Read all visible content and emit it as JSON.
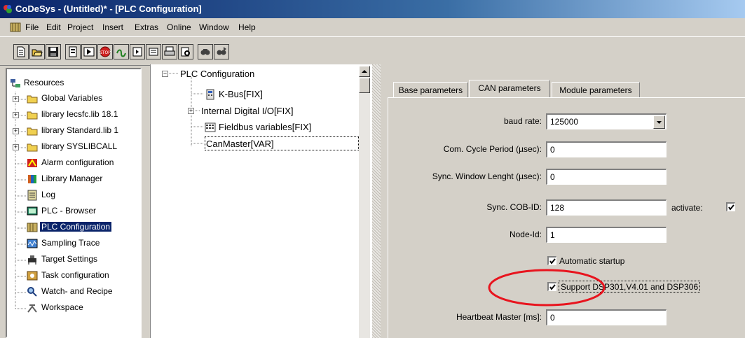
{
  "window": {
    "title": "CoDeSys - (Untitled)* - [PLC Configuration]"
  },
  "menu": [
    "File",
    "Edit",
    "Project",
    "Insert",
    "Extras",
    "Online",
    "Window",
    "Help"
  ],
  "toolbar_icons": [
    "new-icon",
    "open-icon",
    "save-icon",
    "build-icon",
    "stop-icon",
    "step-icon",
    "login-icon",
    "print-icon",
    "print-preview-icon",
    "find-icon",
    "find-next-icon"
  ],
  "resources": {
    "root": "Resources",
    "items": [
      "Global Variables",
      "library Iecsfc.lib 18.1",
      "library Standard.lib 1",
      "library SYSLIBCALL",
      "Alarm configuration",
      "Library Manager",
      "Log",
      "PLC - Browser",
      "PLC Configuration",
      "Sampling Trace",
      "Target Settings",
      "Task configuration",
      "Watch- and Recipe",
      "Workspace"
    ]
  },
  "config_tree": {
    "root": "PLC Configuration",
    "kbus": "K-Bus[FIX]",
    "internal_io": "Internal Digital I/O[FIX]",
    "fieldbus": "Fieldbus variables[FIX]",
    "canmaster": "CanMaster[VAR]"
  },
  "tabs": [
    "Base parameters",
    "CAN parameters",
    "Module parameters"
  ],
  "can": {
    "baud_rate_label": "baud rate:",
    "baud_rate_value": "125000",
    "cycle_label": "Com. Cycle Period (µsec):",
    "cycle_value": "0",
    "sync_window_label": "Sync. Window Lenght (µsec):",
    "sync_window_value": "0",
    "cob_id_label": "Sync. COB-ID:",
    "cob_id_value": "128",
    "activate_label": "activate:",
    "activate_checked": true,
    "node_id_label": "Node-Id:",
    "node_id_value": "1",
    "auto_startup_label": "Automatic startup",
    "auto_startup_checked": true,
    "support_label": "Support DSP301,V4.01 and DSP306",
    "support_checked": true,
    "heartbeat_label": "Heartbeat Master [ms]:",
    "heartbeat_value": "0"
  },
  "colors": {
    "highlight_ellipse": "#e8141e",
    "selection": "#0a246a",
    "title_bar": "#0a246a"
  }
}
